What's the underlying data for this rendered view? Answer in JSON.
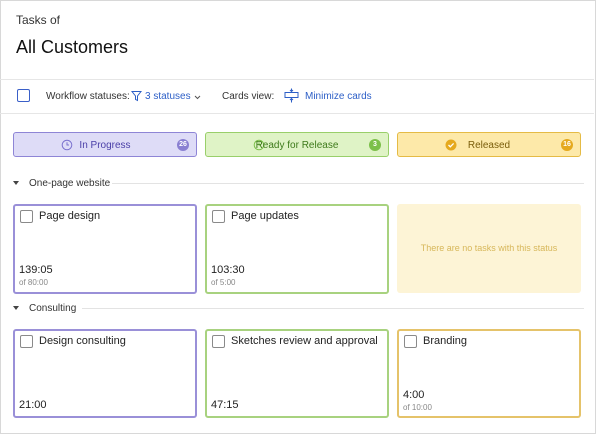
{
  "header": {
    "pretitle": "Tasks of",
    "title": "All Customers"
  },
  "toolbar": {
    "workflow_label": "Workflow statuses:",
    "statuses_link": "3 statuses",
    "cards_view_label": "Cards view:",
    "minimize_link": "Minimize cards",
    "icons": [
      "funnel-icon",
      "chevron-down-icon",
      "minimize-cards-icon"
    ]
  },
  "statuses": [
    {
      "label": "In Progress",
      "count": "26",
      "icon": "clock-icon",
      "color": "#8e85d6"
    },
    {
      "label": "Ready for Release",
      "count": "3",
      "icon": "clock-icon",
      "color": "#7cc04a"
    },
    {
      "label": "Released",
      "count": "16",
      "icon": "check-circle-icon",
      "color": "#e5a91d"
    }
  ],
  "groups": [
    {
      "name": "One-page website",
      "cards": [
        {
          "name": "Page design",
          "time": "139:05",
          "of": "of 80:00"
        },
        {
          "name": "Page updates",
          "time": "103:30",
          "of": "of 5:00"
        }
      ],
      "empty_text": "There are no tasks with this status"
    },
    {
      "name": "Consulting",
      "cards": [
        {
          "name": "Design consulting",
          "time": "21:00",
          "of": ""
        },
        {
          "name": "Sketches review and approval",
          "time": "47:15",
          "of": ""
        },
        {
          "name": "Branding",
          "time": "4:00",
          "of": "of 10:00"
        }
      ]
    }
  ]
}
